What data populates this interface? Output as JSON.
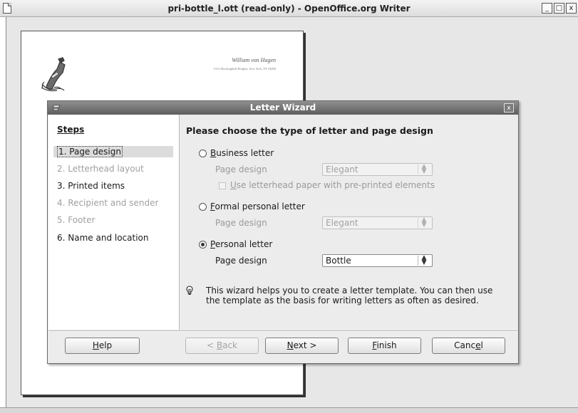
{
  "window": {
    "title": "pri-bottle_l.ott (read-only) - OpenOffice.org Writer",
    "controls": {
      "minimize": "_",
      "maximize": "□",
      "close": "x"
    }
  },
  "document": {
    "sender_name": "William von Hagen",
    "sender_address": "1313 Mockingbird Heights, New York, NY 10000",
    "logo_icon": "bottle-illustration-icon"
  },
  "dialog": {
    "title": "Letter Wizard",
    "close": "x",
    "steps": {
      "heading": "Steps",
      "items": [
        {
          "label": "1. Page design",
          "state": "selected"
        },
        {
          "label": "2. Letterhead layout",
          "state": "disabled"
        },
        {
          "label": "3. Printed items",
          "state": "enabled"
        },
        {
          "label": "4. Recipient and sender",
          "state": "disabled"
        },
        {
          "label": "5. Footer",
          "state": "disabled"
        },
        {
          "label": "6. Name and location",
          "state": "enabled"
        }
      ]
    },
    "content": {
      "heading": "Please choose the type of letter and page design",
      "business": {
        "mnemonic": "B",
        "label_rest": "usiness letter",
        "checked": false,
        "page_design_label": "Page design",
        "page_design_value": "Elegant",
        "letterhead_mnemonic": "U",
        "letterhead_rest": "se letterhead paper with pre-printed elements"
      },
      "formal": {
        "mnemonic": "F",
        "label_rest": "ormal personal letter",
        "checked": false,
        "page_design_label": "Page design",
        "page_design_value": "Elegant"
      },
      "personal": {
        "mnemonic": "P",
        "label_rest": "ersonal letter",
        "checked": true,
        "page_design_label": "Page design",
        "page_design_value": "Bottle"
      },
      "info_icon": "lightbulb-icon",
      "info_text": "This wizard helps you to create a letter template. You can then use the template as the basis for writing letters as often as desired."
    },
    "buttons": {
      "help_mnemonic": "H",
      "help_rest": "elp",
      "back_prefix": "< ",
      "back_mnemonic": "B",
      "back_rest": "ack",
      "next_mnemonic": "N",
      "next_rest": "ext >",
      "finish_mnemonic": "F",
      "finish_rest": "inish",
      "cancel_start": "Canc",
      "cancel_mnemonic": "e",
      "cancel_end": "l"
    }
  },
  "colors": {
    "dialog_titlebar": "#6e6e6e",
    "disabled_text": "#a0a0a0",
    "selected_step_bg": "#dcdcdc"
  }
}
